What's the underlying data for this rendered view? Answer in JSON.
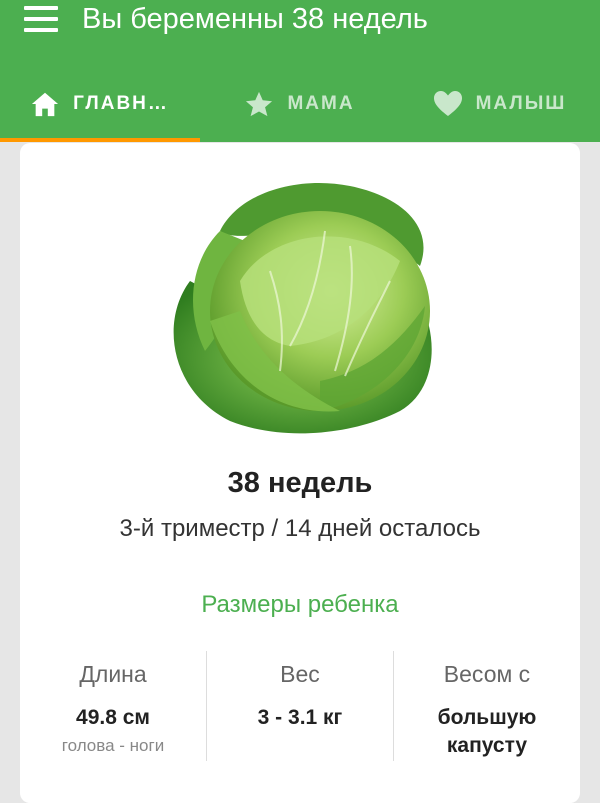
{
  "appbar": {
    "title": "Вы беременны 38 недель",
    "tabs": [
      {
        "label": "ГЛАВН…",
        "icon": "home-icon"
      },
      {
        "label": "МАМА",
        "icon": "star-icon"
      },
      {
        "label": "МАЛЫШ",
        "icon": "heart-icon"
      }
    ]
  },
  "card": {
    "week": "38 недель",
    "subtitle": "3-й триместр / 14 дней осталось",
    "section_title": "Размеры ребенка",
    "stats": [
      {
        "label": "Длина",
        "value": "49.8 см",
        "hint": "голова - ноги"
      },
      {
        "label": "Вес",
        "value": "3 - 3.1 кг"
      },
      {
        "label": "Весом с",
        "value": "большую капусту"
      }
    ],
    "image": "cabbage-image"
  },
  "colors": {
    "primary": "#4caf50",
    "accent": "#ff9800"
  }
}
